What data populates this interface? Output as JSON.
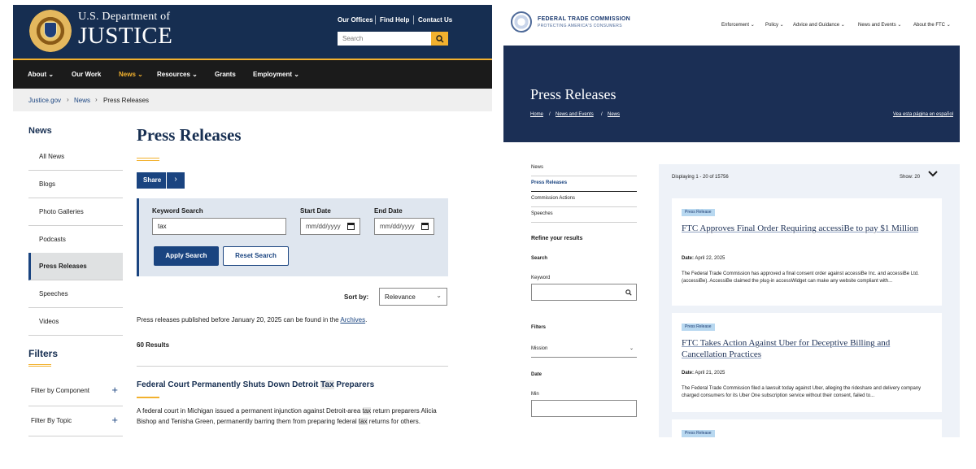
{
  "doj": {
    "header": {
      "dept": "U.S. Department of",
      "title": "JUSTICE",
      "links": [
        "Our Offices",
        "Find Help",
        "Contact Us"
      ],
      "search_placeholder": "Search"
    },
    "nav": [
      "About",
      "Our Work",
      "News",
      "Resources",
      "Grants",
      "Employment"
    ],
    "breadcrumb": [
      "Justice.gov",
      "News",
      "Press Releases"
    ],
    "sidebar": {
      "title": "News",
      "items": [
        "All News",
        "Blogs",
        "Photo Galleries",
        "Podcasts",
        "Press Releases",
        "Speeches",
        "Videos"
      ],
      "active": "Press Releases"
    },
    "filters": {
      "title": "Filters",
      "items": [
        "Filter by Component",
        "Filter By Topic"
      ]
    },
    "main": {
      "title": "Press Releases",
      "share_label": "Share",
      "search": {
        "keyword_label": "Keyword Search",
        "keyword_value": "tax",
        "start_label": "Start Date",
        "end_label": "End Date",
        "date_placeholder": "mm/dd/yyyy",
        "apply_label": "Apply Search",
        "reset_label": "Reset Search"
      },
      "sort_label": "Sort by:",
      "sort_value": "Relevance",
      "archive_prefix": "Press releases published before January 20, 2025 can be found in the ",
      "archive_link": "Archives",
      "archive_suffix": ".",
      "results": "60 Results",
      "article": {
        "title_a": "Federal Court Permanently Shuts Down Detroit ",
        "title_hl": "Tax",
        "title_b": " Preparers",
        "body_a": "A federal court in Michigan issued a permanent injunction against Detroit-area ",
        "body_hl1": "tax",
        "body_b": " return preparers Alicia Bishop and Tenisha Green, permanently barring them from preparing federal ",
        "body_hl2": "tax",
        "body_c": " returns for others."
      }
    }
  },
  "ftc": {
    "header": {
      "name": "FEDERAL TRADE COMMISSION",
      "tagline": "PROTECTING AMERICA'S CONSUMERS",
      "nav": [
        "Enforcement",
        "Policy",
        "Advice and Guidance",
        "News and Events",
        "About the FTC"
      ]
    },
    "hero": {
      "title": "Press Releases",
      "breadcrumb": [
        "Home",
        "News and Events",
        "News"
      ],
      "espanol": "Vea esta página en español"
    },
    "sidebar": {
      "items": [
        "News",
        "Press Releases",
        "Commission Actions",
        "Speeches"
      ],
      "active": "Press Releases",
      "refine": "Refine your results",
      "search_label": "Search",
      "keyword_label": "Keyword",
      "filters_label": "Filters",
      "mission_value": "Mission",
      "date_label": "Date",
      "min_label": "Min"
    },
    "list": {
      "displaying": "Displaying 1 - 20 of 15756",
      "show_label": "Show:",
      "show_value": "20",
      "cards": [
        {
          "badge": "Press Release",
          "title": "FTC Approves Final Order Requiring accessiBe to pay $1 Million",
          "date_label": "Date:",
          "date": "April 22, 2025",
          "body": "The Federal Trade Commission has approved a final consent order against accessiBe Inc. and accessiBe Ltd. (accessiBe). AccessiBe claimed the plug-in accessWidget can make any website compliant with..."
        },
        {
          "badge": "Press Release",
          "title": "FTC Takes Action Against Uber for Deceptive Billing and Cancellation Practices",
          "date_label": "Date:",
          "date": "April 21, 2025",
          "body": "The Federal Trade Commission filed a lawsuit today against Uber, alleging the rideshare and delivery company charged consumers for its Uber One subscription service without their consent, failed to..."
        },
        {
          "badge": "Press Release"
        }
      ]
    }
  }
}
